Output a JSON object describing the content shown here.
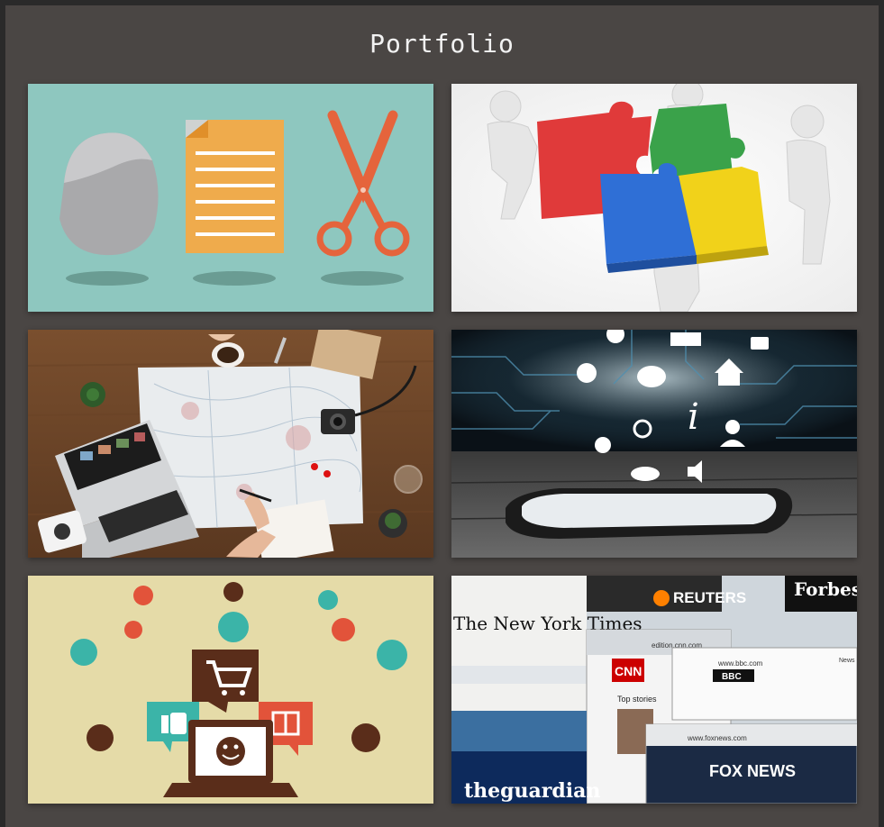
{
  "page": {
    "title": "Portfolio"
  },
  "tiles": [
    {
      "id": "stationery",
      "icons": [
        "stone-icon",
        "document-icon",
        "scissors-icon"
      ]
    },
    {
      "id": "puzzle-team",
      "icons": [
        "puzzle-piece-icon"
      ]
    },
    {
      "id": "travel-map",
      "icons": [
        "map-icon",
        "laptop-icon",
        "camera-icon"
      ]
    },
    {
      "id": "smartphone-apps",
      "icons": [
        "globe-icon",
        "mail-icon",
        "lock-icon",
        "lightbulb-icon",
        "chat-icon",
        "home-icon",
        "info-icon",
        "search-icon",
        "person-icon",
        "sun-icon",
        "cloud-icon",
        "speaker-icon"
      ]
    },
    {
      "id": "ecommerce",
      "icons": [
        "cart-icon",
        "thumbs-up-icon",
        "gift-icon",
        "laptop-icon",
        "smiley-icon",
        "airplane-icon",
        "gamepad-icon",
        "music-icon",
        "ticket-icon",
        "phone-icon",
        "monitor-icon"
      ]
    },
    {
      "id": "news-sites",
      "labels": {
        "nyt": "The New York Times",
        "reuters": "REUTERS",
        "forbes": "Forbes",
        "cnn": "CNN",
        "bbc": "BBC",
        "cnn_url": "edition.cnn.com",
        "bbc_url": "www.bbc.com",
        "foxnews_url": "www.foxnews.com",
        "foxnews": "FOX NEWS",
        "guardian": "theguardian",
        "top_stories": "Top stories",
        "news": "News"
      }
    }
  ]
}
